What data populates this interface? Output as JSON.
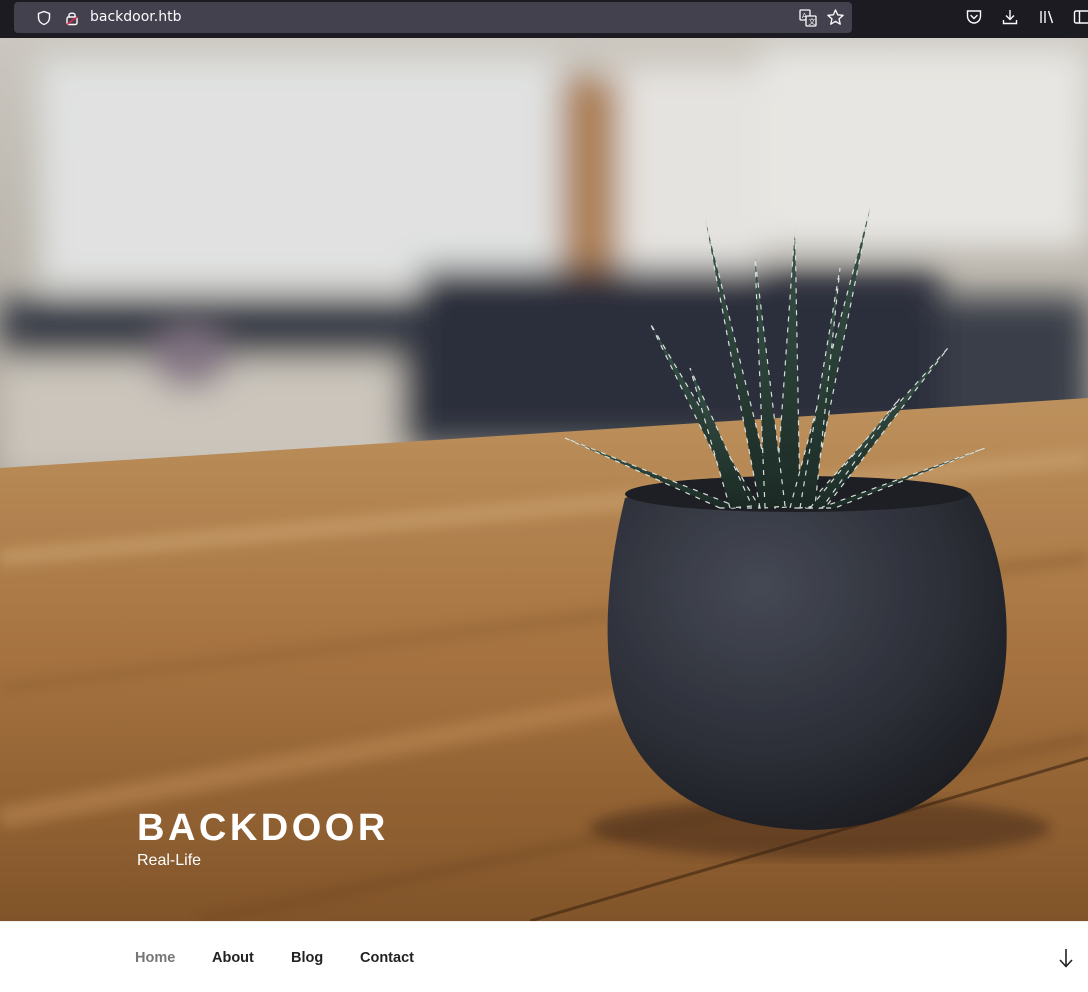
{
  "browser": {
    "url": "backdoor.htb",
    "icons": [
      "shield-icon",
      "lock-icon",
      "translate-icon",
      "bookmark-star-icon",
      "pocket-icon",
      "download-icon",
      "library-icon",
      "sidebar-icon"
    ]
  },
  "site": {
    "title": "BACKDOOR",
    "tagline": "Real-Life"
  },
  "nav": {
    "items": [
      "Home",
      "About",
      "Blog",
      "Contact"
    ],
    "current": "Home",
    "scroll_icon": "arrow-down-icon"
  },
  "colors": {
    "toolbar_bg": "#1c1b22",
    "urlbar_bg": "#42414d",
    "nav_text": "#222222",
    "nav_current": "#767676"
  }
}
